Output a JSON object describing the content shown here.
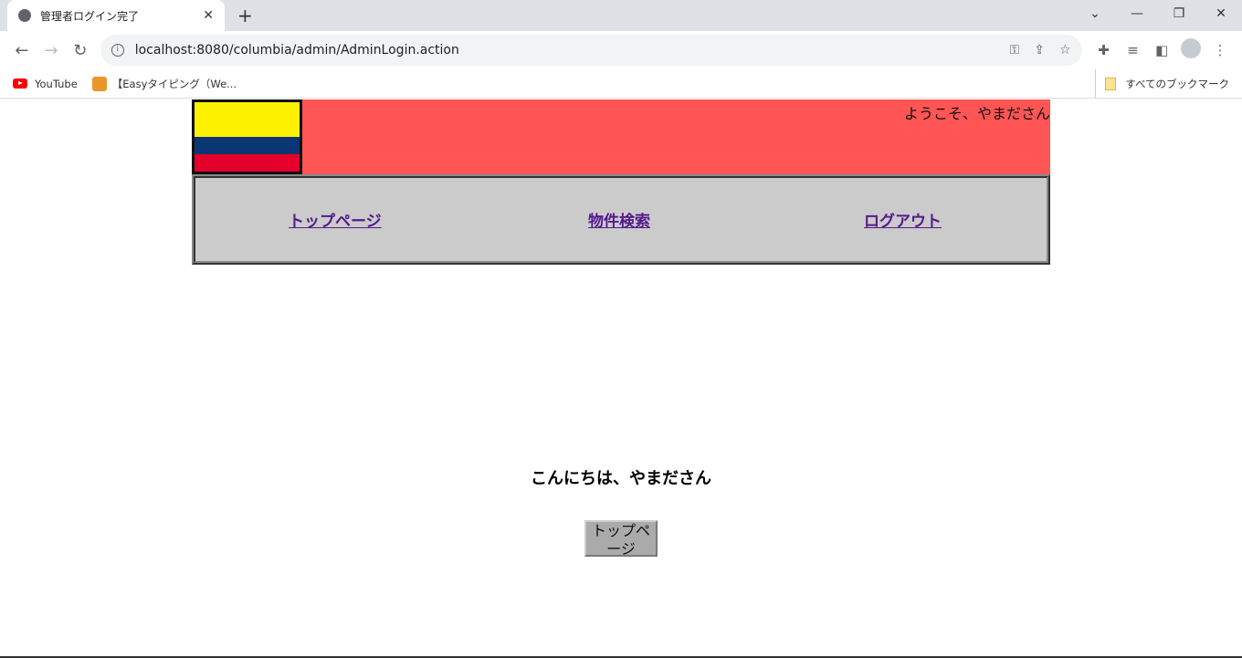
{
  "browser": {
    "tab_title": "管理者ログイン完了",
    "url": "localhost:8080/columbia/admin/AdminLogin.action",
    "bookmarks": [
      {
        "label": "YouTube",
        "icon": "youtube-icon"
      },
      {
        "label": "【Easyタイピング（We...",
        "icon": "cat-icon"
      }
    ],
    "all_bookmarks": "すべてのブックマーク"
  },
  "header": {
    "welcome": "ようこそ、やまださん",
    "flag_colors": [
      "#fff200",
      "#0b3674",
      "#e4002b"
    ],
    "background": "#ff5555"
  },
  "nav": {
    "items": [
      {
        "label": "トップページ"
      },
      {
        "label": "物件検索"
      },
      {
        "label": "ログアウト"
      }
    ]
  },
  "main": {
    "greeting": "こんにちは、やまださん",
    "top_button": "トップページ"
  }
}
